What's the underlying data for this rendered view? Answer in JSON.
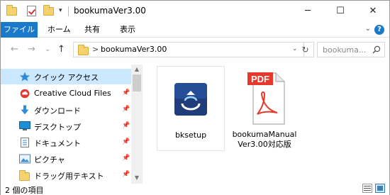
{
  "window": {
    "title": "bookumaVer3.00",
    "minimize": "─",
    "maximize": "☐",
    "close": "✕"
  },
  "quick_access_toolbar": {
    "dropdown": "▾"
  },
  "ribbon": {
    "tabs": [
      "ファイル",
      "ホーム",
      "共有",
      "表示"
    ],
    "expand": "⌄",
    "help": "?"
  },
  "navigation": {
    "back": "←",
    "forward": "→",
    "recent": "⌄",
    "up": "↑",
    "path_separator": ">",
    "path": "bookumaVer3.00",
    "path_dropdown": "⌄",
    "refresh": "↻",
    "search_placeholder": "bookuma..."
  },
  "nav_pane": {
    "items": [
      {
        "label": "クイック アクセス",
        "icon": "star-icon",
        "pinned": false,
        "selected": true
      },
      {
        "label": "Creative Cloud Files",
        "icon": "creative-cloud-icon",
        "pinned": true,
        "selected": false
      },
      {
        "label": "ダウンロード",
        "icon": "download-icon",
        "pinned": true,
        "selected": false
      },
      {
        "label": "デスクトップ",
        "icon": "desktop-icon",
        "pinned": true,
        "selected": false
      },
      {
        "label": "ドキュメント",
        "icon": "document-icon",
        "pinned": true,
        "selected": false
      },
      {
        "label": "ピクチャ",
        "icon": "picture-icon",
        "pinned": true,
        "selected": false
      },
      {
        "label": "ドラッグ用テキスト",
        "icon": "folder-icon",
        "pinned": true,
        "selected": false
      }
    ],
    "pin_glyph": "📌"
  },
  "files": [
    {
      "name": "bksetup",
      "icon": "installer-icon"
    },
    {
      "name": "bookumaManual Ver3.00対応版",
      "icon": "pdf-icon",
      "badge": "PDF"
    }
  ],
  "status": {
    "item_count": "2 個の項目"
  },
  "colors": {
    "accent": "#1979ca",
    "selection": "#cce8ff",
    "pdf_red": "#e8382b"
  }
}
